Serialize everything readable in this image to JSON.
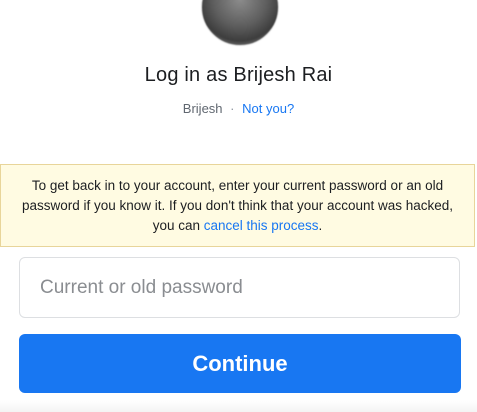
{
  "header": {
    "title": "Log in as Brijesh Rai",
    "username": "Brijesh",
    "separator": "·",
    "not_you_link": "Not you?"
  },
  "notice": {
    "text_before": "To get back in to your account, enter your current password or an old password if you know it. If you don't think that your account was hacked, you can ",
    "cancel_link": "cancel this process",
    "text_after": "."
  },
  "form": {
    "password_placeholder": "Current or old password",
    "password_value": "",
    "continue_label": "Continue"
  },
  "colors": {
    "accent": "#1877f2",
    "notice_background": "#fffbe2",
    "notice_border": "#e8d59a"
  }
}
